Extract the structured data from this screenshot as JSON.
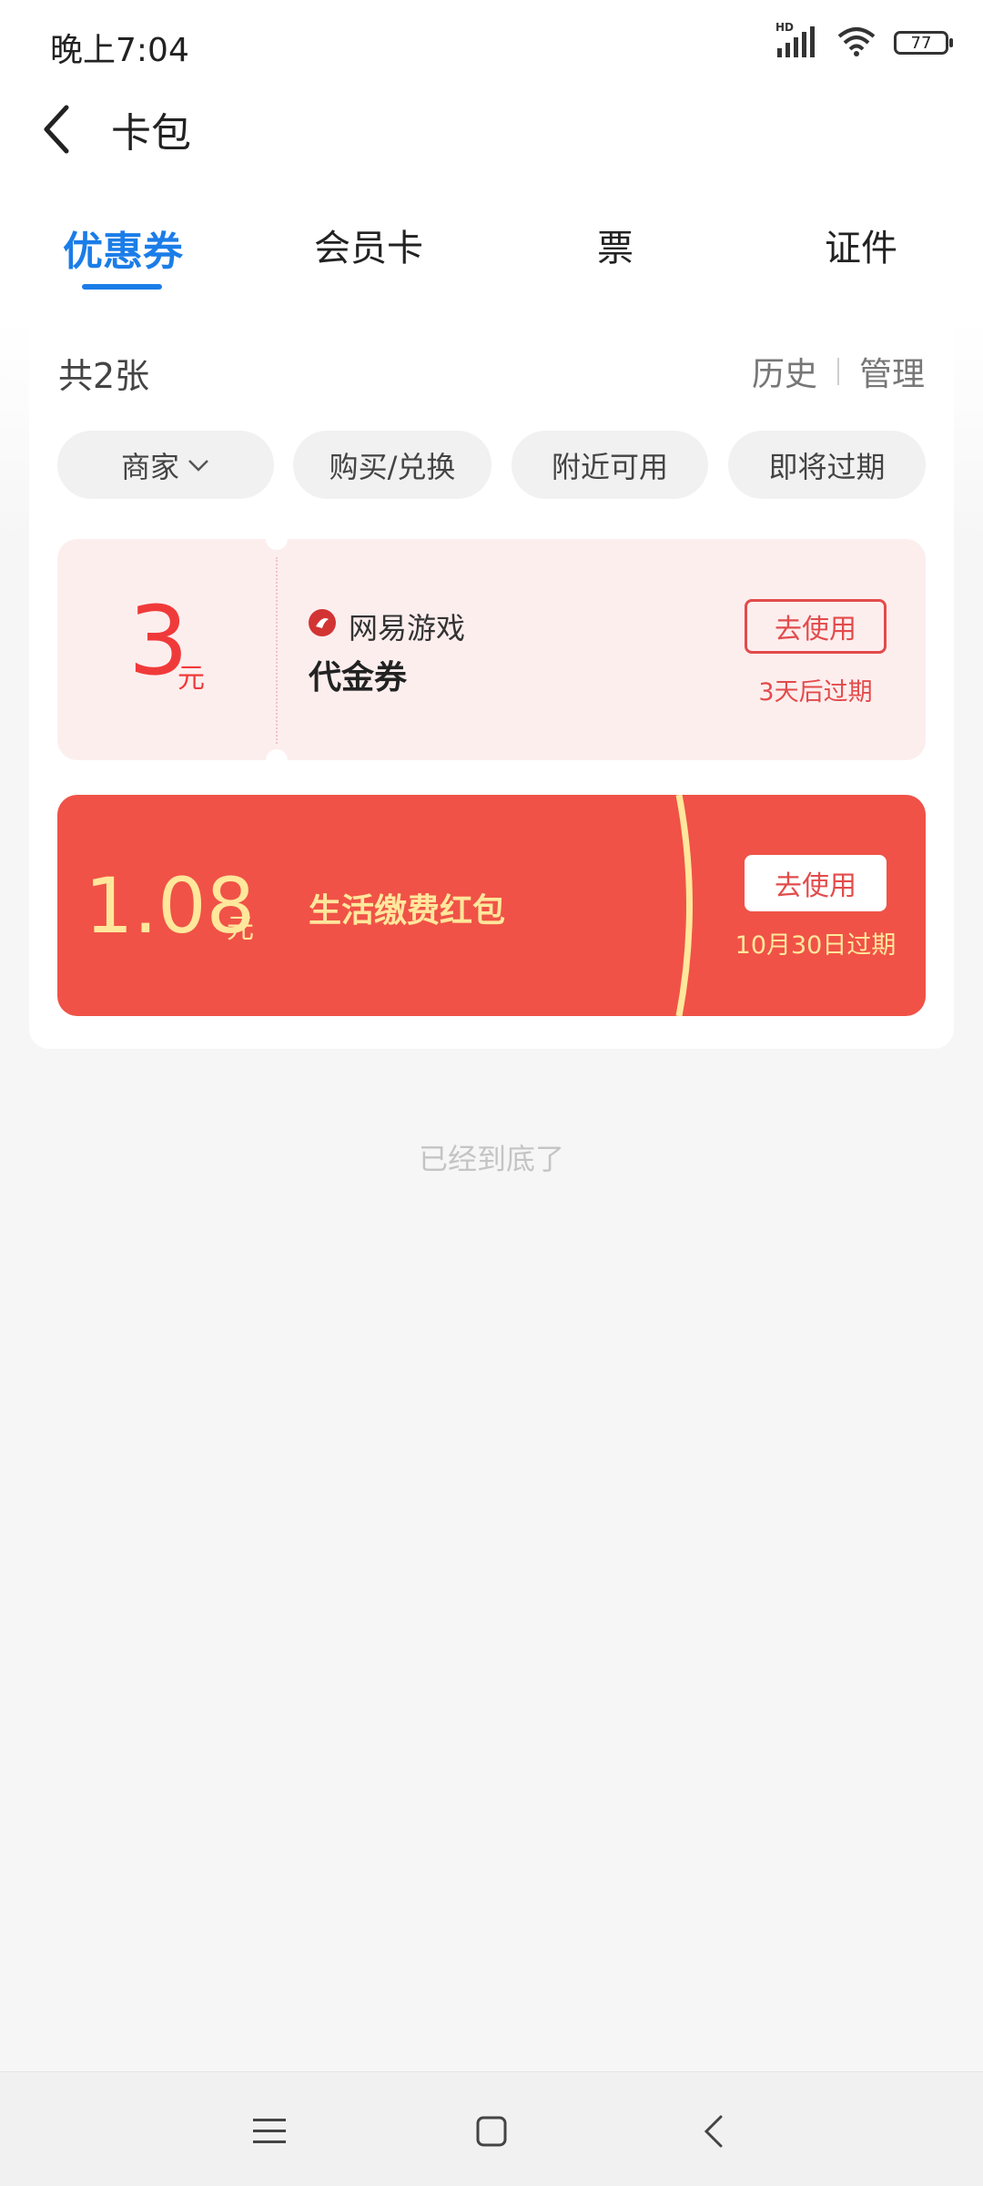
{
  "status_bar": {
    "time": "晚上7:04",
    "network_label": "HD",
    "battery": "77"
  },
  "header": {
    "title": "卡包"
  },
  "tabs": [
    {
      "label": "优惠券",
      "active": true
    },
    {
      "label": "会员卡",
      "active": false
    },
    {
      "label": "票",
      "active": false
    },
    {
      "label": "证件",
      "active": false
    }
  ],
  "summary": {
    "count": "共2张",
    "history": "历史",
    "manage": "管理"
  },
  "filters": [
    {
      "label": "商家"
    },
    {
      "label": "购买/兑换"
    },
    {
      "label": "附近可用"
    },
    {
      "label": "即将过期"
    }
  ],
  "coupons": [
    {
      "amount": "3",
      "unit": "元",
      "merchant": "网易游戏",
      "type": "代金券",
      "action": "去使用",
      "expiry": "3天后过期"
    },
    {
      "amount": "1.08",
      "unit": "元",
      "title": "生活缴费红包",
      "action": "去使用",
      "expiry": "10月30日过期"
    }
  ],
  "footer": {
    "end_text": "已经到底了"
  },
  "colors": {
    "accent": "#1b7de8",
    "coupon_red": "#f05247",
    "coupon_pink": "#fdeeee",
    "gold": "#ffe79c"
  }
}
